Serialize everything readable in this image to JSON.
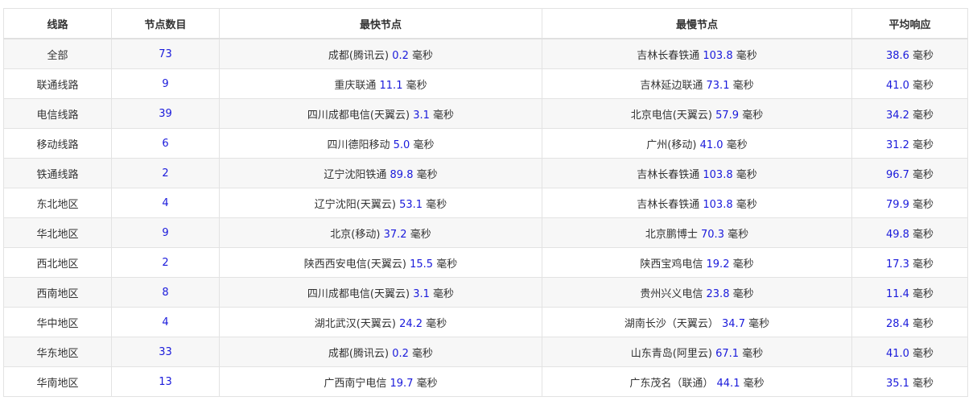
{
  "headers": [
    "线路",
    "节点数目",
    "最快节点",
    "最慢节点",
    "平均响应"
  ],
  "rows": [
    {
      "route": "全部",
      "count": "73",
      "fast_name": "成都(腾讯云)",
      "fast_val": "0.2",
      "slow_name": "吉林长春铁通",
      "slow_val": "103.8",
      "avg_val": "38.6"
    },
    {
      "route": "联通线路",
      "count": "9",
      "fast_name": "重庆联通",
      "fast_val": "11.1",
      "slow_name": "吉林延边联通",
      "slow_val": "73.1",
      "avg_val": "41.0"
    },
    {
      "route": "电信线路",
      "count": "39",
      "fast_name": "四川成都电信(天翼云)",
      "fast_val": "3.1",
      "slow_name": "北京电信(天翼云)",
      "slow_val": "57.9",
      "avg_val": "34.2"
    },
    {
      "route": "移动线路",
      "count": "6",
      "fast_name": "四川德阳移动",
      "fast_val": "5.0",
      "slow_name": "广州(移动)",
      "slow_val": "41.0",
      "avg_val": "31.2"
    },
    {
      "route": "铁通线路",
      "count": "2",
      "fast_name": "辽宁沈阳铁通",
      "fast_val": "89.8",
      "slow_name": "吉林长春铁通",
      "slow_val": "103.8",
      "avg_val": "96.7"
    },
    {
      "route": "东北地区",
      "count": "4",
      "fast_name": "辽宁沈阳(天翼云)",
      "fast_val": "53.1",
      "slow_name": "吉林长春铁通",
      "slow_val": "103.8",
      "avg_val": "79.9"
    },
    {
      "route": "华北地区",
      "count": "9",
      "fast_name": "北京(移动)",
      "fast_val": "37.2",
      "slow_name": "北京鹏博士",
      "slow_val": "70.3",
      "avg_val": "49.8"
    },
    {
      "route": "西北地区",
      "count": "2",
      "fast_name": "陕西西安电信(天翼云)",
      "fast_val": "15.5",
      "slow_name": "陕西宝鸡电信",
      "slow_val": "19.2",
      "avg_val": "17.3"
    },
    {
      "route": "西南地区",
      "count": "8",
      "fast_name": "四川成都电信(天翼云)",
      "fast_val": "3.1",
      "slow_name": "贵州兴义电信",
      "slow_val": "23.8",
      "avg_val": "11.4"
    },
    {
      "route": "华中地区",
      "count": "4",
      "fast_name": "湖北武汉(天翼云)",
      "fast_val": "24.2",
      "slow_name": "湖南长沙（天翼云）",
      "slow_val": "34.7",
      "avg_val": "28.4"
    },
    {
      "route": "华东地区",
      "count": "33",
      "fast_name": "成都(腾讯云)",
      "fast_val": "0.2",
      "slow_name": "山东青岛(阿里云)",
      "slow_val": "67.1",
      "avg_val": "41.0"
    },
    {
      "route": "华南地区",
      "count": "13",
      "fast_name": "广西南宁电信",
      "fast_val": "19.7",
      "slow_name": "广东茂名（联通）",
      "slow_val": "44.1",
      "avg_val": "35.1"
    }
  ],
  "unit": "毫秒",
  "colors": {
    "number": "#1a1adb",
    "text": "#333333",
    "border": "#e3e3e3",
    "stripe": "#f7f7f7"
  }
}
